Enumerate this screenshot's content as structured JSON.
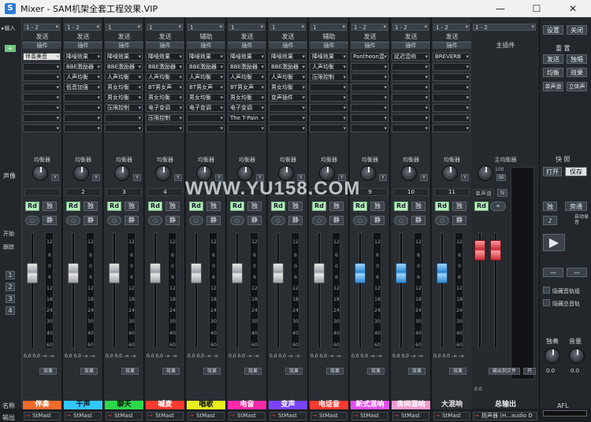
{
  "window": {
    "title": "Mixer - SAM机架全套工程效果.VIP",
    "minimize": "—",
    "maximize": "☐",
    "close": "✕",
    "icon": "S"
  },
  "left": {
    "input_label": "▸输入",
    "pan_label": "声像",
    "start_label": "开始",
    "follow_label": "跟踪",
    "nums": [
      "1",
      "2",
      "3",
      "4"
    ],
    "name_label": "名称",
    "output_label": "输出"
  },
  "channels": [
    {
      "input": "1 - 2",
      "send_title": "发送",
      "plugin_title": "插件",
      "plugins": [
        "伴奏美音",
        "",
        "",
        "",
        "",
        "",
        "",
        ""
      ],
      "eq": "均衡器",
      "num": "",
      "name": "伴奏",
      "name_color": "#f06a2a",
      "out": "StMast",
      "fader": 0.35,
      "fclass": ""
    },
    {
      "input": "1 - 2",
      "send_title": "发送",
      "plugin_title": "插件",
      "plugins": [
        "降噪效果",
        "BBE激励器",
        "人声均衡",
        "低音加强",
        "",
        "",
        "",
        ""
      ],
      "eq": "均衡器",
      "num": "2",
      "name": "干声",
      "name_color": "#32c8ff",
      "out": "StMast",
      "fader": 0.35,
      "fclass": ""
    },
    {
      "input": "1",
      "send_title": "发送",
      "plugin_title": "插件",
      "plugins": [
        "降噪效果",
        "BBE激励器",
        "人声均衡",
        "男女均衡",
        "男女均衡",
        "压限控制",
        "",
        ""
      ],
      "eq": "均衡器",
      "num": "3",
      "name": "聊天",
      "name_color": "#2bd84a",
      "out": "StMast",
      "fader": 0.35,
      "fclass": ""
    },
    {
      "input": "1",
      "send_title": "发送",
      "plugin_title": "插件",
      "plugins": [
        "降噪效果",
        "BBE激励器",
        "人声均衡",
        "BT男女声",
        "男女均衡",
        "电子变调",
        "压限控制",
        ""
      ],
      "eq": "均衡器",
      "num": "4",
      "name": "喊麦",
      "name_color": "#ff3a2f",
      "out": "StMast",
      "fader": 0.35,
      "fclass": ""
    },
    {
      "input": "1",
      "send_title": "辅助",
      "plugin_title": "插件",
      "plugins": [
        "降噪效果",
        "BBE激励器",
        "人声均衡",
        "BT男女声",
        "男女均衡",
        "电子变调",
        "",
        ""
      ],
      "eq": "均衡器",
      "num": "",
      "name": "唱歌",
      "name_color": "#e8f020",
      "out": "StMast",
      "fader": 0.35,
      "fclass": ""
    },
    {
      "input": "1",
      "send_title": "发送",
      "plugin_title": "插件",
      "plugins": [
        "降噪效果",
        "BBE激励器",
        "人声均衡",
        "BT男女声",
        "男女均衡",
        "电子变调",
        "The T-Pain",
        ""
      ],
      "eq": "均衡器",
      "num": "",
      "name": "电音",
      "name_color": "#ff2aa8",
      "out": "StMast",
      "fader": 0.35,
      "fclass": ""
    },
    {
      "input": "1",
      "send_title": "发送",
      "plugin_title": "插件",
      "plugins": [
        "降噪效果",
        "BBE激励器",
        "人声均衡",
        "男女均衡",
        "变声插件",
        "",
        "",
        ""
      ],
      "eq": "均衡器",
      "num": "",
      "name": "变声",
      "name_color": "#7a44ff",
      "out": "StMast",
      "fader": 0.35,
      "fclass": ""
    },
    {
      "input": "1",
      "send_title": "辅助",
      "plugin_title": "插件",
      "plugins": [
        "降噪效果",
        "人声均衡",
        "压限控制",
        "",
        "",
        "",
        "",
        ""
      ],
      "eq": "均衡器",
      "num": "",
      "name": "电话音",
      "name_color": "#ff3a2f",
      "out": "StMast",
      "fader": 0.35,
      "fclass": ""
    },
    {
      "input": "1 - 2",
      "send_title": "发送",
      "plugin_title": "插件",
      "plugins": [
        "Pantheon混",
        "",
        "",
        "",
        "",
        "",
        "",
        ""
      ],
      "eq": "均衡器",
      "num": "9",
      "name": "新式混响",
      "name_color": "#e34df0",
      "out": "StMast",
      "fader": 0.35,
      "fclass": "blue"
    },
    {
      "input": "1 - 2",
      "send_title": "发送",
      "plugin_title": "插件",
      "plugins": [
        "延迟混响",
        "",
        "",
        "",
        "",
        "",
        "",
        ""
      ],
      "eq": "均衡器",
      "num": "10",
      "name": "房间混响",
      "name_color": "#f09ad0",
      "out": "StMast",
      "fader": 0.35,
      "fclass": "blue"
    },
    {
      "input": "1 - 2",
      "send_title": "发送",
      "plugin_title": "插件",
      "plugins": [
        "BREVERB",
        "",
        "",
        "",
        "",
        "",
        "",
        ""
      ],
      "eq": "均衡器",
      "num": "11",
      "name": "大混响",
      "name_color": "#2a2e33",
      "out": "StMast",
      "fader": 0.35,
      "fclass": "blue"
    }
  ],
  "master": {
    "input": "1 - 2",
    "plugin_title": "主插件",
    "eq": "主均衡器",
    "pan_val": "100",
    "se": "SE",
    "mono": "单声道",
    "n": "N",
    "rd": "Rd",
    "name": "总输出",
    "out": "扬声器 (H...audio D",
    "out_file": "输出到文件",
    "open": "开",
    "db": "0.0"
  },
  "side": {
    "settings": "设置",
    "close": "关闭",
    "reset": "重 置",
    "send": "发送",
    "solo": "独唱",
    "eq": "均衡",
    "fx": "效果",
    "mono": "单声道",
    "stereo": "立体声",
    "quick": "快 照",
    "open": "打开",
    "save": "保存",
    "solo2": "独",
    "pass": "旁通",
    "auto": "自动录音",
    "minus1": "—",
    "minus2": "—",
    "hide_aux": "隐藏音轨组",
    "hide_all": "隐藏总音轨",
    "solo_knob": "独奏",
    "vol_knob": "音量",
    "db1": "0.0",
    "db2": "0.0",
    "afl": "AFL"
  },
  "scale": [
    "12",
    "6",
    "0",
    "6",
    "12",
    "18",
    "24",
    "30",
    "40",
    "60"
  ],
  "db_readout": "0.0  0.0  -∞  -∞",
  "watermark": "WWW.YU158.COM"
}
